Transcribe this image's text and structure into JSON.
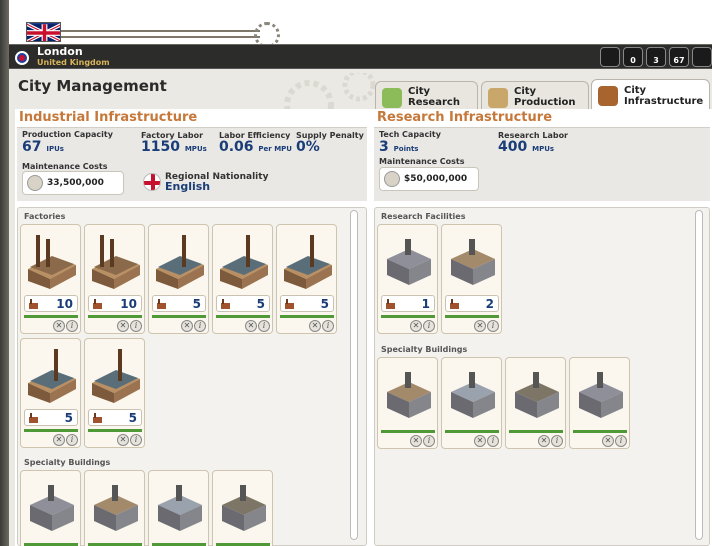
{
  "city": {
    "name": "London",
    "country": "United Kingdom"
  },
  "resources": [
    {
      "icon": "capitol-icon",
      "value": ""
    },
    {
      "icon": "labor-icon",
      "value": "0"
    },
    {
      "icon": "flask-icon",
      "value": "3"
    },
    {
      "icon": "factory-icon",
      "value": "67"
    },
    {
      "icon": "check-icon",
      "value": ""
    }
  ],
  "title": "City Management",
  "tabs": [
    {
      "label": "City Research",
      "icon": "flask-icon",
      "color": "#8cbc5a"
    },
    {
      "label": "City Production",
      "icon": "factory-icon",
      "color": "#c9a76a"
    },
    {
      "label": "City Infrastructure",
      "icon": "infrastructure-icon",
      "color": "#a7642f"
    }
  ],
  "industrial": {
    "title": "Industrial Infrastructure",
    "stats": [
      {
        "label": "Production Capacity",
        "value": "67",
        "unit": "IPUs"
      },
      {
        "label": "Factory Labor",
        "value": "1150",
        "unit": "MPUs"
      },
      {
        "label": "Labor Efficiency",
        "value": "0.06",
        "unit": "Per MPU"
      },
      {
        "label": "Supply Penalty",
        "value": "0%",
        "unit": ""
      }
    ],
    "maint_label": "Maintenance Costs",
    "maint_value": "33,500,000",
    "nat_label": "Regional Nationality",
    "nat_value": "English",
    "factories_label": "Factories",
    "factories": [
      10,
      10,
      5,
      5,
      5,
      5,
      5
    ],
    "specialty_label": "Specialty Buildings"
  },
  "research": {
    "title": "Research Infrastructure",
    "stats": [
      {
        "label": "Tech Capacity",
        "value": "3",
        "unit": "Points"
      },
      {
        "label": "Research Labor",
        "value": "400",
        "unit": "MPUs"
      }
    ],
    "maint_label": "Maintenance Costs",
    "maint_value": "$50,000,000",
    "facilities_label": "Research Facilities",
    "facilities": [
      1,
      2
    ],
    "specialty_label": "Specialty Buildings"
  }
}
